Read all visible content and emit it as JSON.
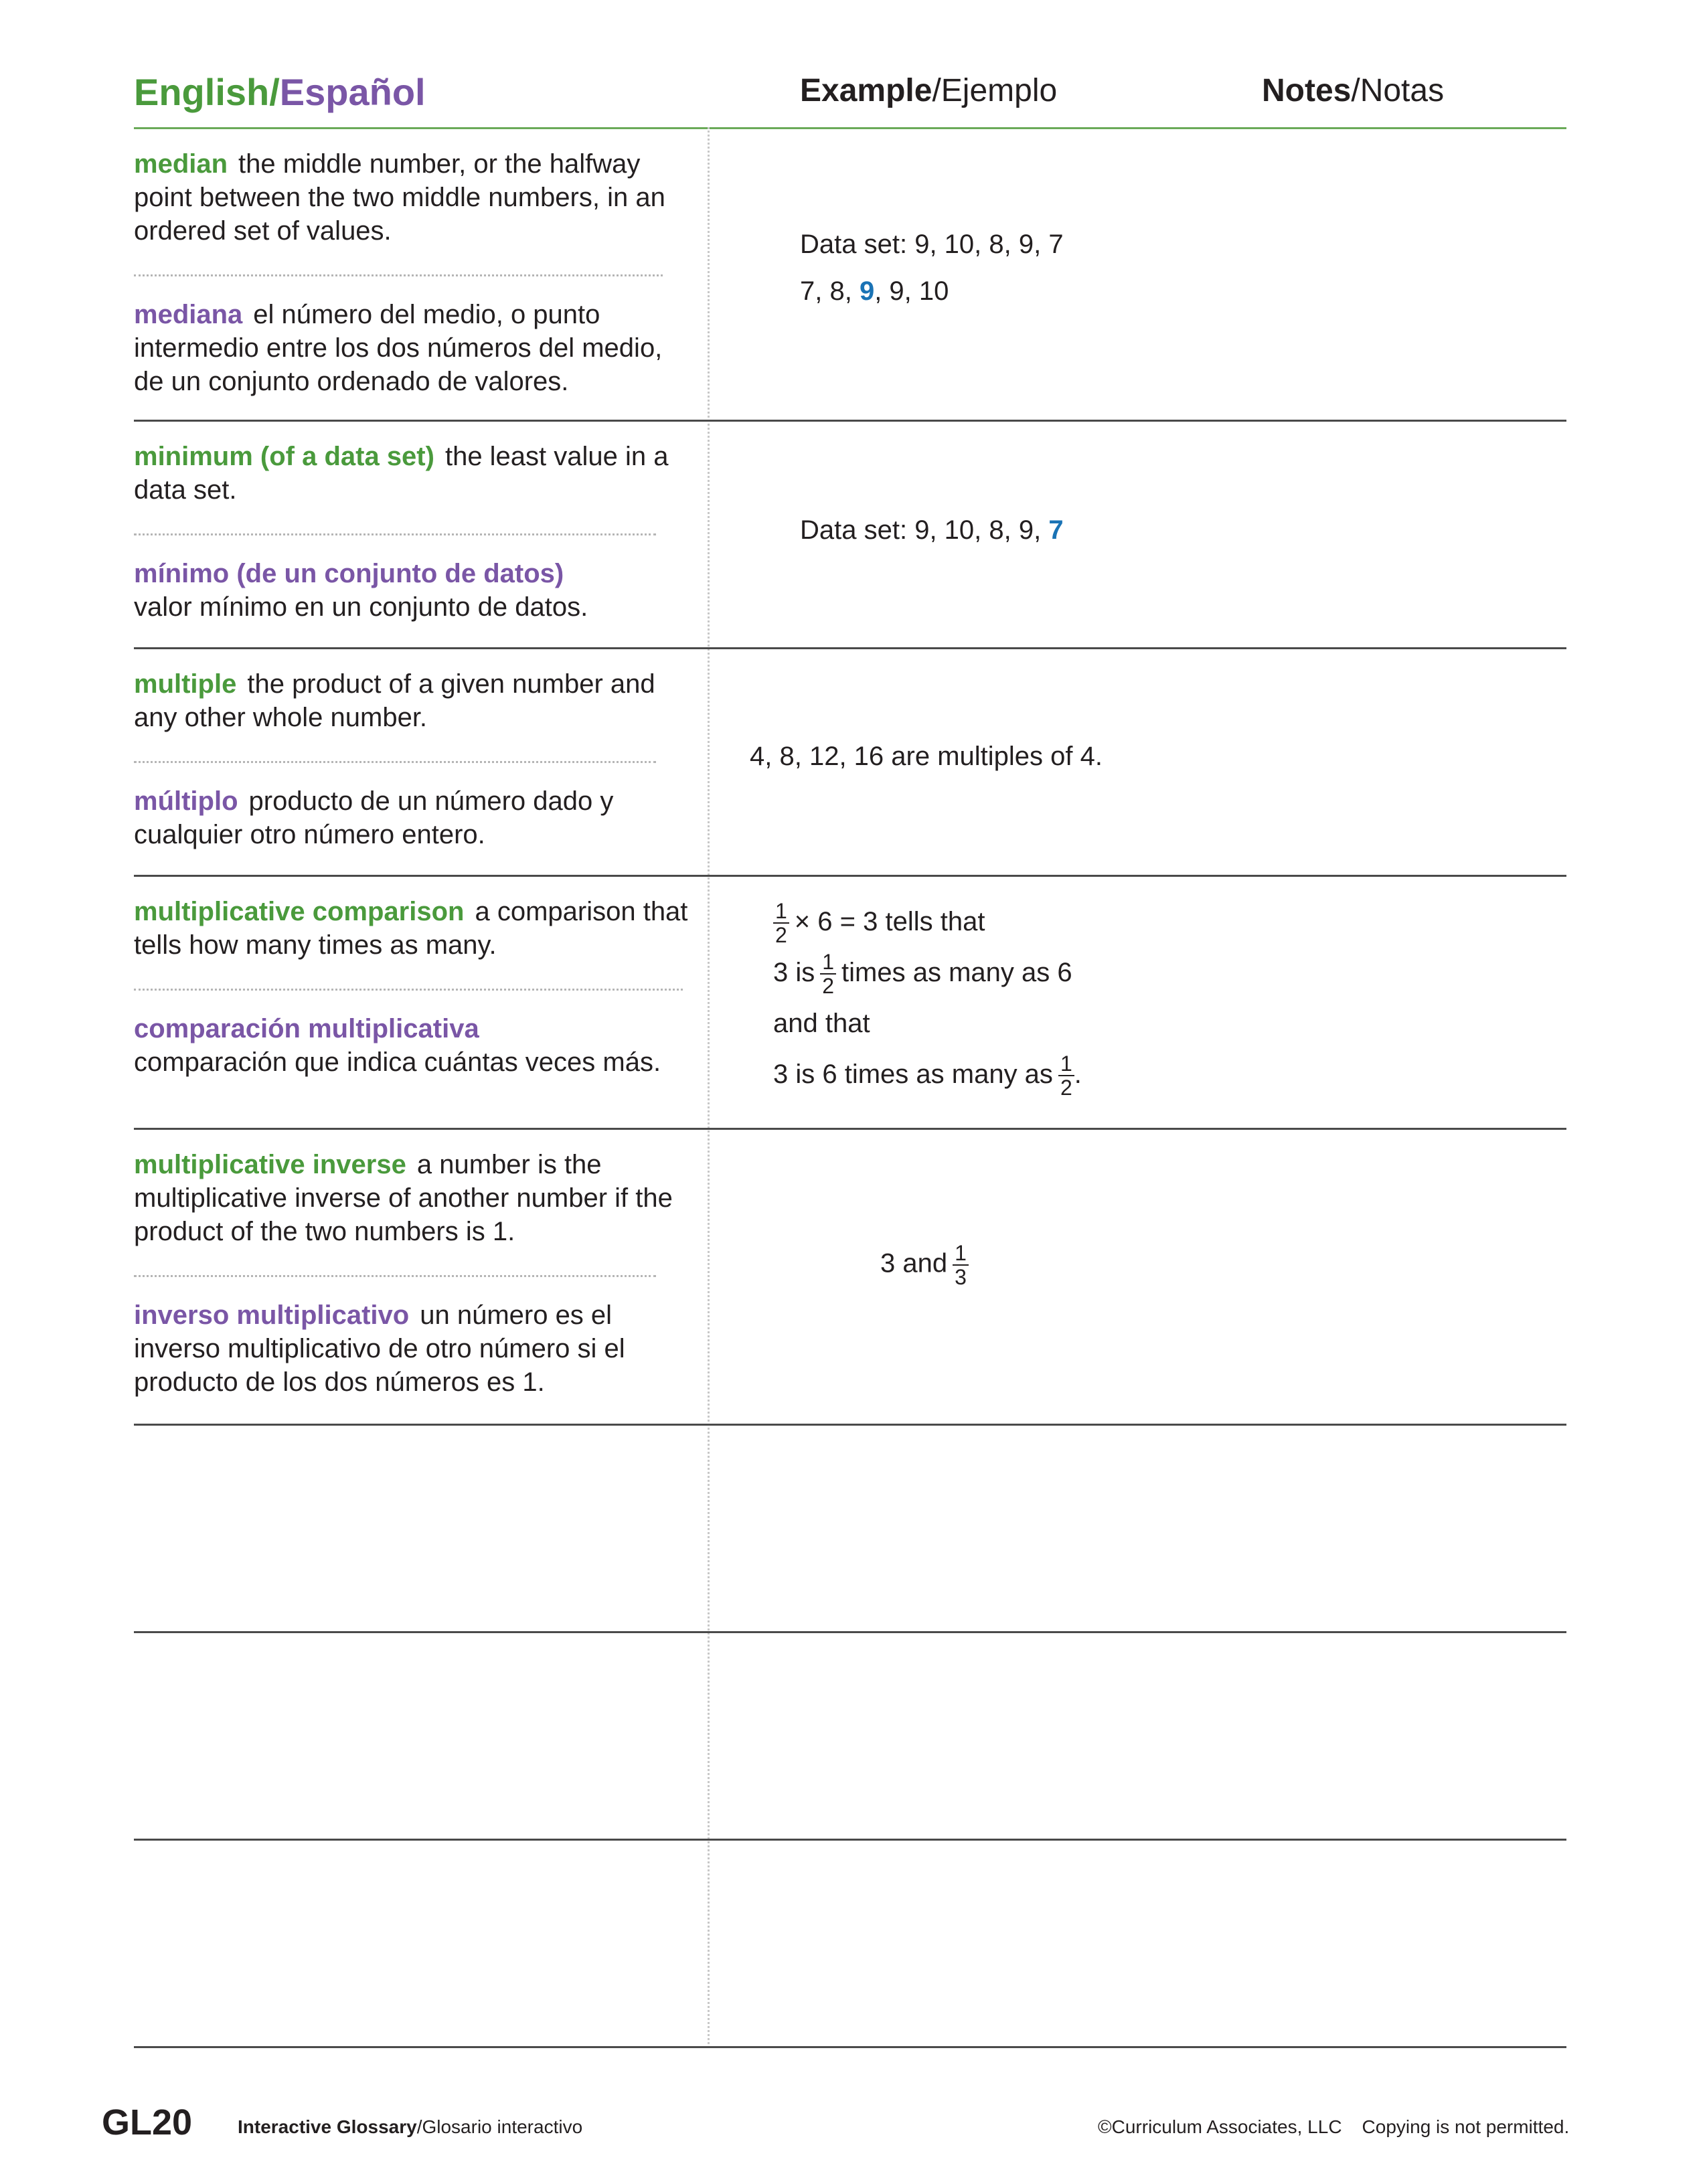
{
  "header": {
    "english": "English",
    "slash": "/",
    "espanol": "Español",
    "example_bold": "Example",
    "example_rest": "/Ejemplo",
    "notes_bold": "Notes",
    "notes_rest": "/Notas"
  },
  "entries": [
    {
      "term_en": "median",
      "def_en": "the middle number, or the halfway point between the two middle numbers, in an ordered set of values.",
      "term_es": "mediana",
      "def_es": "el número del medio, o punto intermedio entre los dos números del medio, de un conjunto ordenado de valores.",
      "example": {
        "line1": "Data set: 9, 10, 8, 9, 7",
        "line2_pre": "7, 8, ",
        "line2_hl": "9",
        "line2_post": ", 9, 10"
      }
    },
    {
      "term_en": "minimum (of a data set)",
      "def_en": "the least value in a data set.",
      "term_es": "mínimo (de un conjunto de datos)",
      "def_es": "valor mínimo en un conjunto de datos.",
      "example": {
        "line1_pre": "Data set: 9, 10, 8, 9, ",
        "line1_hl": "7"
      }
    },
    {
      "term_en": "multiple",
      "def_en": "the product of a given number and any other whole number.",
      "term_es": "múltiplo",
      "def_es": "producto de un número dado y cualquier otro número entero.",
      "example": {
        "line1": "4, 8, 12, 16 are multiples of 4."
      }
    },
    {
      "term_en": "multiplicative comparison",
      "def_en": "a comparison that tells how many times as many.",
      "term_es": "comparación multiplicativa",
      "def_es": "comparación que indica cuántas veces más.",
      "example": {
        "frac_num": "1",
        "frac_den": "2",
        "line1_post": "× 6 = 3 tells that",
        "line2_pre": "3 is",
        "line2_post": "times  as many as 6",
        "line3": "and that",
        "line4_pre": "3 is 6 times as many as",
        "line4_post": "."
      }
    },
    {
      "term_en": "multiplicative inverse",
      "def_en": "a number is the multiplicative inverse of another number if the product of the two numbers is 1.",
      "term_es": "inverso multiplicativo",
      "def_es": "un número es el inverso multiplicativo de otro número si el producto de los dos números es 1.",
      "example": {
        "line1_pre": "3 and",
        "frac_num": "1",
        "frac_den": "3"
      }
    }
  ],
  "footer": {
    "code": "GL20",
    "title_bold": "Interactive Glossary",
    "title_rest": "/Glosario interactivo",
    "copyright": "©Curriculum Associates, LLC",
    "notice": "Copying is not permitted."
  }
}
